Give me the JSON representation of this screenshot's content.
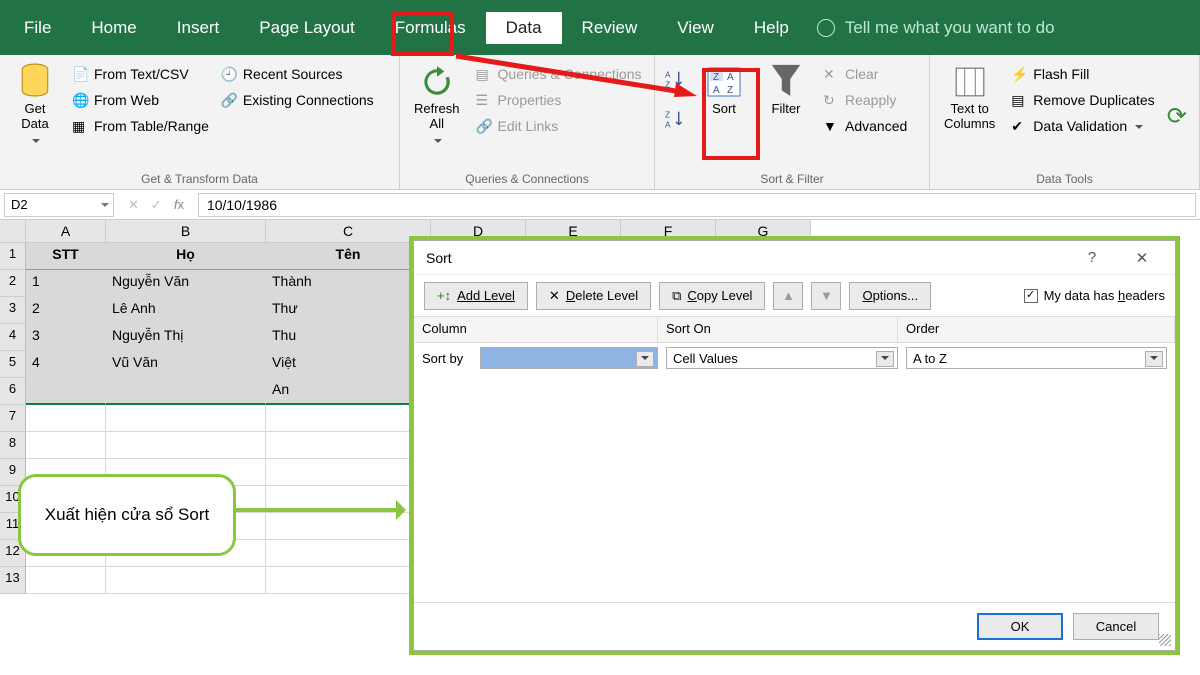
{
  "tabs": {
    "file": "File",
    "home": "Home",
    "insert": "Insert",
    "page": "Page Layout",
    "formulas": "Formulas",
    "data": "Data",
    "review": "Review",
    "view": "View",
    "help": "Help",
    "tellme": "Tell me what you want to do"
  },
  "ribbon": {
    "get_data": "Get\nData",
    "from_text": "From Text/CSV",
    "from_web": "From Web",
    "from_table": "From Table/Range",
    "recent": "Recent Sources",
    "existing": "Existing Connections",
    "group_get": "Get & Transform Data",
    "refresh": "Refresh\nAll",
    "queries": "Queries & Connections",
    "properties": "Properties",
    "editlinks": "Edit Links",
    "group_qc": "Queries & Connections",
    "sort": "Sort",
    "filter": "Filter",
    "clear": "Clear",
    "reapply": "Reapply",
    "advanced": "Advanced",
    "group_sf": "Sort & Filter",
    "txtcol": "Text to\nColumns",
    "flash": "Flash Fill",
    "remdup": "Remove Duplicates",
    "datav": "Data Validation",
    "group_dt": "Data Tools"
  },
  "fbar": {
    "cell": "D2",
    "value": "10/10/1986"
  },
  "cols": [
    "A",
    "B",
    "C",
    "D",
    "E",
    "F",
    "G"
  ],
  "headers": {
    "stt": "STT",
    "ho": "Họ",
    "ten": "Tên"
  },
  "rows": [
    {
      "n": "1",
      "stt": "1",
      "ho": "Nguyễn Văn",
      "ten": "Thành"
    },
    {
      "n": "2",
      "stt": "2",
      "ho": "Lê Anh",
      "ten": "Thư"
    },
    {
      "n": "3",
      "stt": "3",
      "ho": "Nguyễn Thị",
      "ten": "Thu"
    },
    {
      "n": "4",
      "stt": "4",
      "ho": "Vũ Văn",
      "ten": "Việt"
    },
    {
      "n": "5",
      "stt": "",
      "ho": "",
      "ten": "An"
    }
  ],
  "callout_text": "Xuất hiện cửa sổ Sort",
  "dlg": {
    "title": "Sort",
    "help": "?",
    "close": "✕",
    "add": "Add Level",
    "del": "Delete Level",
    "copy": "Copy Level",
    "opts": "Options...",
    "headers": "My data has headers",
    "col_hdr": "Column",
    "sorton_hdr": "Sort On",
    "order_hdr": "Order",
    "sortby": "Sort by",
    "sorton_val": "Cell Values",
    "order_val": "A to Z",
    "ok": "OK",
    "cancel": "Cancel"
  }
}
